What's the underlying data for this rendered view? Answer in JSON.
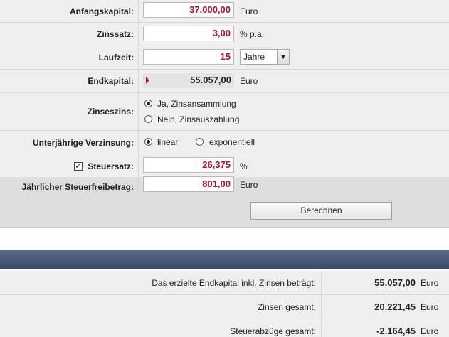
{
  "form": {
    "anfangskapital": {
      "label": "Anfangskapital:",
      "value": "37.000,00",
      "unit": "Euro"
    },
    "zinssatz": {
      "label": "Zinssatz:",
      "value": "3,00",
      "unit": "% p.a."
    },
    "laufzeit": {
      "label": "Laufzeit:",
      "value": "15",
      "select_value": "Jahre"
    },
    "endkapital": {
      "label": "Endkapital:",
      "value": "55.057,00",
      "unit": "Euro"
    },
    "zinseszins": {
      "label": "Zinseszins:",
      "option_yes": "Ja, Zinsansammlung",
      "option_no": "Nein, Zinsauszahlung",
      "selected": "yes"
    },
    "verzinsung": {
      "label": "Unterjährige Verzinsung:",
      "option_linear": "linear",
      "option_exp": "exponentiell",
      "selected": "linear"
    },
    "steuersatz": {
      "label": "Steuersatz:",
      "checked": true,
      "value": "26,375",
      "unit": "%"
    },
    "freibetrag": {
      "label": "Jährlicher Steuerfreibetrag:",
      "value": "801,00",
      "unit": "Euro"
    },
    "submit_label": "Berechnen"
  },
  "results": [
    {
      "label": "Das erzielte Endkapital inkl. Zinsen beträgt:",
      "value": "55.057,00",
      "unit": "Euro"
    },
    {
      "label": "Zinsen gesamt:",
      "value": "20.221,45",
      "unit": "Euro"
    },
    {
      "label": "Steuerabzüge gesamt:",
      "value": "-2.164,45",
      "unit": "Euro"
    }
  ],
  "colors": {
    "value_text": "#a8122a",
    "header_band": "#4a5878",
    "row_bg": "#efefef"
  }
}
